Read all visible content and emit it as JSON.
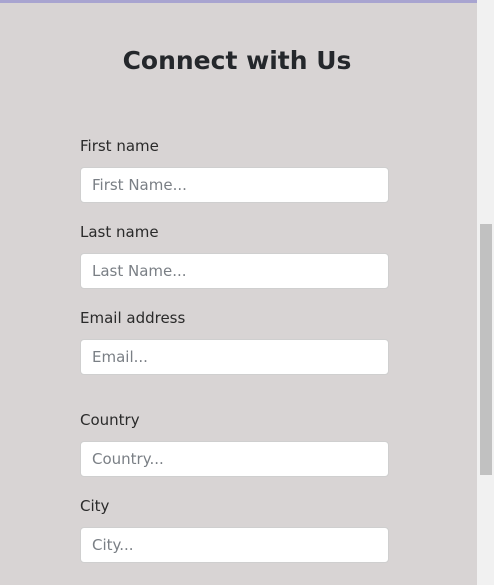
{
  "form": {
    "title": "Connect with Us",
    "fields": [
      {
        "label": "First name",
        "placeholder": "First Name..."
      },
      {
        "label": "Last name",
        "placeholder": "Last Name..."
      },
      {
        "label": "Email address",
        "placeholder": "Email..."
      },
      {
        "label": "Country",
        "placeholder": "Country..."
      },
      {
        "label": "City",
        "placeholder": "City..."
      }
    ]
  },
  "colors": {
    "background": "#d8d4d4",
    "accent_bar": "#a8a4d0",
    "input_background": "#ffffff",
    "scrollbar_thumb": "#c1c1c1"
  }
}
